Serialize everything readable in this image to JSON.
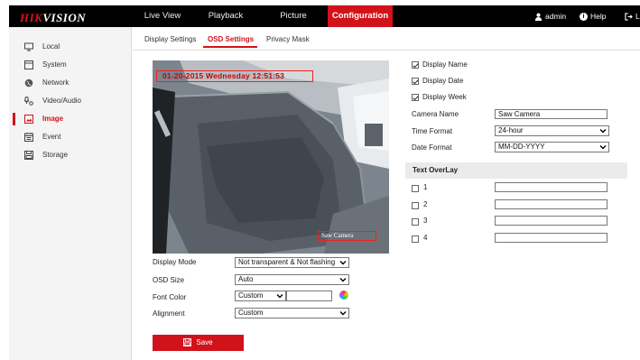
{
  "brand": {
    "logo_hik": "HIK",
    "logo_vision": "VISION"
  },
  "nav": {
    "items": [
      {
        "label": "Live View"
      },
      {
        "label": "Playback"
      },
      {
        "label": "Picture"
      },
      {
        "label": "Configuration"
      }
    ],
    "active_index": 3,
    "user": "admin",
    "help": "Help",
    "logout": "L"
  },
  "sidebar": {
    "items": [
      {
        "label": "Local",
        "icon": "monitor-icon"
      },
      {
        "label": "System",
        "icon": "system-icon"
      },
      {
        "label": "Network",
        "icon": "globe-icon"
      },
      {
        "label": "Video/Audio",
        "icon": "video-audio-icon"
      },
      {
        "label": "Image",
        "icon": "image-icon"
      },
      {
        "label": "Event",
        "icon": "calendar-icon"
      },
      {
        "label": "Storage",
        "icon": "storage-icon"
      }
    ],
    "active_index": 4
  },
  "tabs": {
    "items": [
      {
        "label": "Display Settings"
      },
      {
        "label": "OSD Settings"
      },
      {
        "label": "Privacy Mask"
      }
    ],
    "active_index": 1
  },
  "video": {
    "osd_datetime": "01-20-2015 Wednesday 12:51:53",
    "osd_camera_name": "Saw Camera"
  },
  "form": {
    "display_mode": {
      "label": "Display Mode",
      "value": "Not transparent & Not flashing"
    },
    "osd_size": {
      "label": "OSD Size",
      "value": "Auto"
    },
    "font_color": {
      "label": "Font Color",
      "value": "Custom"
    },
    "alignment": {
      "label": "Alignment",
      "value": "Custom"
    },
    "save_label": "Save"
  },
  "right": {
    "display_name": {
      "label": "Display Name",
      "checked": true
    },
    "display_date": {
      "label": "Display Date",
      "checked": true
    },
    "display_week": {
      "label": "Display Week",
      "checked": true
    },
    "camera_name": {
      "label": "Camera Name",
      "value": "Saw Camera"
    },
    "time_format": {
      "label": "Time Format",
      "value": "24-hour"
    },
    "date_format": {
      "label": "Date Format",
      "value": "MM-DD-YYYY"
    },
    "text_overlay": {
      "title": "Text OverLay",
      "rows": [
        {
          "num": "1",
          "checked": false,
          "value": ""
        },
        {
          "num": "2",
          "checked": false,
          "value": ""
        },
        {
          "num": "3",
          "checked": false,
          "value": ""
        },
        {
          "num": "4",
          "checked": false,
          "value": ""
        }
      ]
    }
  },
  "colors": {
    "accent": "#d2121b",
    "topbar": "#000000",
    "sidebar_bg": "#f4f4f4"
  }
}
